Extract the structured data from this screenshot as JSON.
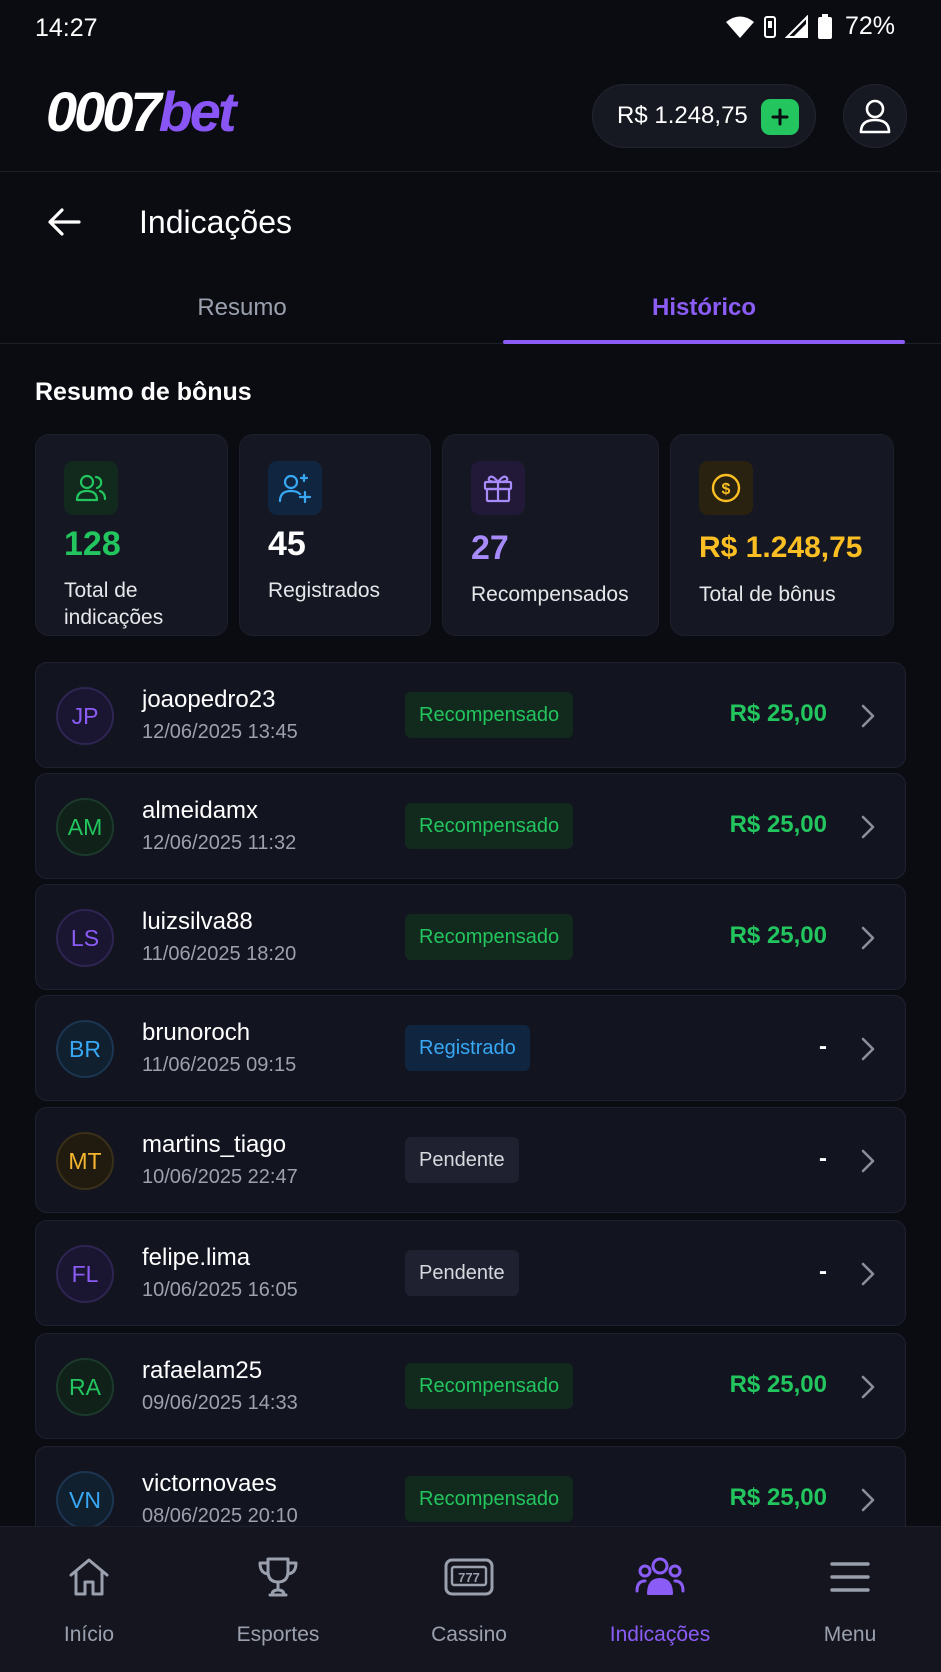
{
  "status_bar": {
    "time": "14:27",
    "battery": "72%"
  },
  "header": {
    "logo_part1": "0007",
    "logo_part2": "bet",
    "balance": "R$ 1.248,75",
    "colors": {
      "accent": "#8b5cf6",
      "success": "#22c55e"
    }
  },
  "page": {
    "title": "Indicações"
  },
  "tabs": [
    {
      "label": "Resumo",
      "active": false
    },
    {
      "label": "Histórico",
      "active": true
    }
  ],
  "summary": {
    "title": "Resumo de bônus",
    "cards": [
      {
        "icon": "users-icon",
        "value": "128",
        "label_line1": "Total de",
        "label_line2": "indicações",
        "color": "#22c55e"
      },
      {
        "icon": "user-plus-icon",
        "value": "45",
        "label_line1": "Registrados",
        "label_line2": "",
        "color": "#ffffff"
      },
      {
        "icon": "gift-icon",
        "value": "27",
        "label_line1": "Recompensados",
        "label_line2": "",
        "color": "#a78bfa"
      },
      {
        "icon": "coin-icon",
        "value": "R$ 1.248,75",
        "label_line1": "Total de bônus",
        "label_line2": "",
        "color": "#fbbf24"
      }
    ]
  },
  "referrals": [
    {
      "initials": "JP",
      "name": "joaopedro23",
      "date": "12/06/2025 13:45",
      "status": "Recompensado",
      "amount": "R$ 25,00"
    },
    {
      "initials": "AM",
      "name": "almeidamx",
      "date": "12/06/2025 11:32",
      "status": "Recompensado",
      "amount": "R$ 25,00"
    },
    {
      "initials": "LS",
      "name": "luizsilva88",
      "date": "11/06/2025 18:20",
      "status": "Recompensado",
      "amount": "R$ 25,00"
    },
    {
      "initials": "BR",
      "name": "brunoroch",
      "date": "11/06/2025 09:15",
      "status": "Registrado",
      "amount": "-"
    },
    {
      "initials": "MT",
      "name": "martins_tiago",
      "date": "10/06/2025 22:47",
      "status": "Pendente",
      "amount": "-"
    },
    {
      "initials": "FL",
      "name": "felipe.lima",
      "date": "10/06/2025 16:05",
      "status": "Pendente",
      "amount": "-"
    },
    {
      "initials": "RA",
      "name": "rafaelam25",
      "date": "09/06/2025 14:33",
      "status": "Recompensado",
      "amount": "R$ 25,00"
    },
    {
      "initials": "VN",
      "name": "victornovaes",
      "date": "08/06/2025 20:10",
      "status": "Recompensado",
      "amount": "R$ 25,00"
    }
  ],
  "bottom_nav": [
    {
      "label": "Início",
      "icon": "home-icon",
      "active": false
    },
    {
      "label": "Esportes",
      "icon": "trophy-icon",
      "active": false
    },
    {
      "label": "Cassino",
      "icon": "slot-machine-icon",
      "active": false
    },
    {
      "label": "Indicações",
      "icon": "users-icon",
      "active": true
    },
    {
      "label": "Menu",
      "icon": "menu-icon",
      "active": false
    }
  ]
}
